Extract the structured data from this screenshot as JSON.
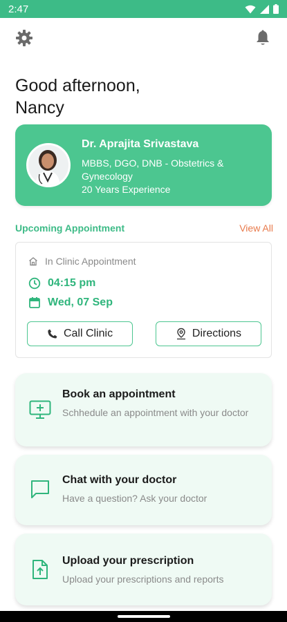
{
  "status_bar": {
    "time": "2:47"
  },
  "greeting": {
    "line1": "Good afternoon,",
    "line2": "Nancy"
  },
  "doctor": {
    "name": "Dr. Aprajita Srivastava",
    "qualifications": "MBBS, DGO, DNB - Obstetrics & Gynecology",
    "experience": "20 Years Experience"
  },
  "upcoming": {
    "title": "Upcoming Appointment",
    "view_all": "View All",
    "type": "In Clinic Appointment",
    "time": "04:15 pm",
    "date": "Wed, 07 Sep",
    "call_label": "Call Clinic",
    "directions_label": "Directions"
  },
  "actions": [
    {
      "title": "Book an appointment",
      "subtitle": "Schhedule an appointment with your doctor",
      "icon": "monitor-plus-icon"
    },
    {
      "title": "Chat with your doctor",
      "subtitle": "Have a question? Ask your doctor",
      "icon": "chat-icon"
    },
    {
      "title": "Upload your prescription",
      "subtitle": "Upload your prescriptions and reports",
      "icon": "upload-file-icon"
    }
  ],
  "colors": {
    "accent": "#3dbb87",
    "card_green": "#4cc690",
    "link_orange": "#e8794a",
    "action_bg": "#effaf4"
  }
}
